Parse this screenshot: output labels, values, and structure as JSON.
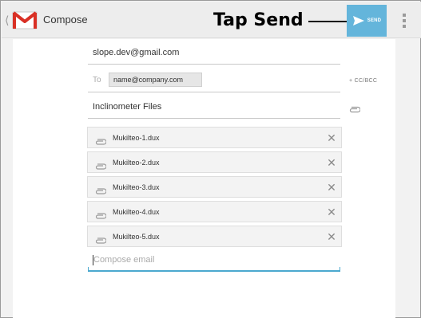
{
  "action_bar": {
    "title": "Compose",
    "send_label": "SEND",
    "icons": [
      "up-caret-icon",
      "gmail-logo-icon",
      "send-icon",
      "overflow-menu-icon"
    ]
  },
  "annotation": {
    "callout": "Tap Send"
  },
  "compose": {
    "from": "slope.dev@gmail.com",
    "to_label": "To",
    "to_recipient": "name@company.com",
    "cc_bcc_label": "+ CC/BCC",
    "subject": "Inclinometer Files",
    "attachments": [
      {
        "name": "Mukilteo-1.dux"
      },
      {
        "name": "Mukilteo-2.dux"
      },
      {
        "name": "Mukilteo-3.dux"
      },
      {
        "name": "Mukilteo-4.dux"
      },
      {
        "name": "Mukilteo-5.dux"
      }
    ],
    "body_placeholder": "Compose email"
  },
  "colors": {
    "send_button": "#64b5db",
    "focus_underline": "#4ba9cf",
    "gmail_red": "#d93025"
  }
}
